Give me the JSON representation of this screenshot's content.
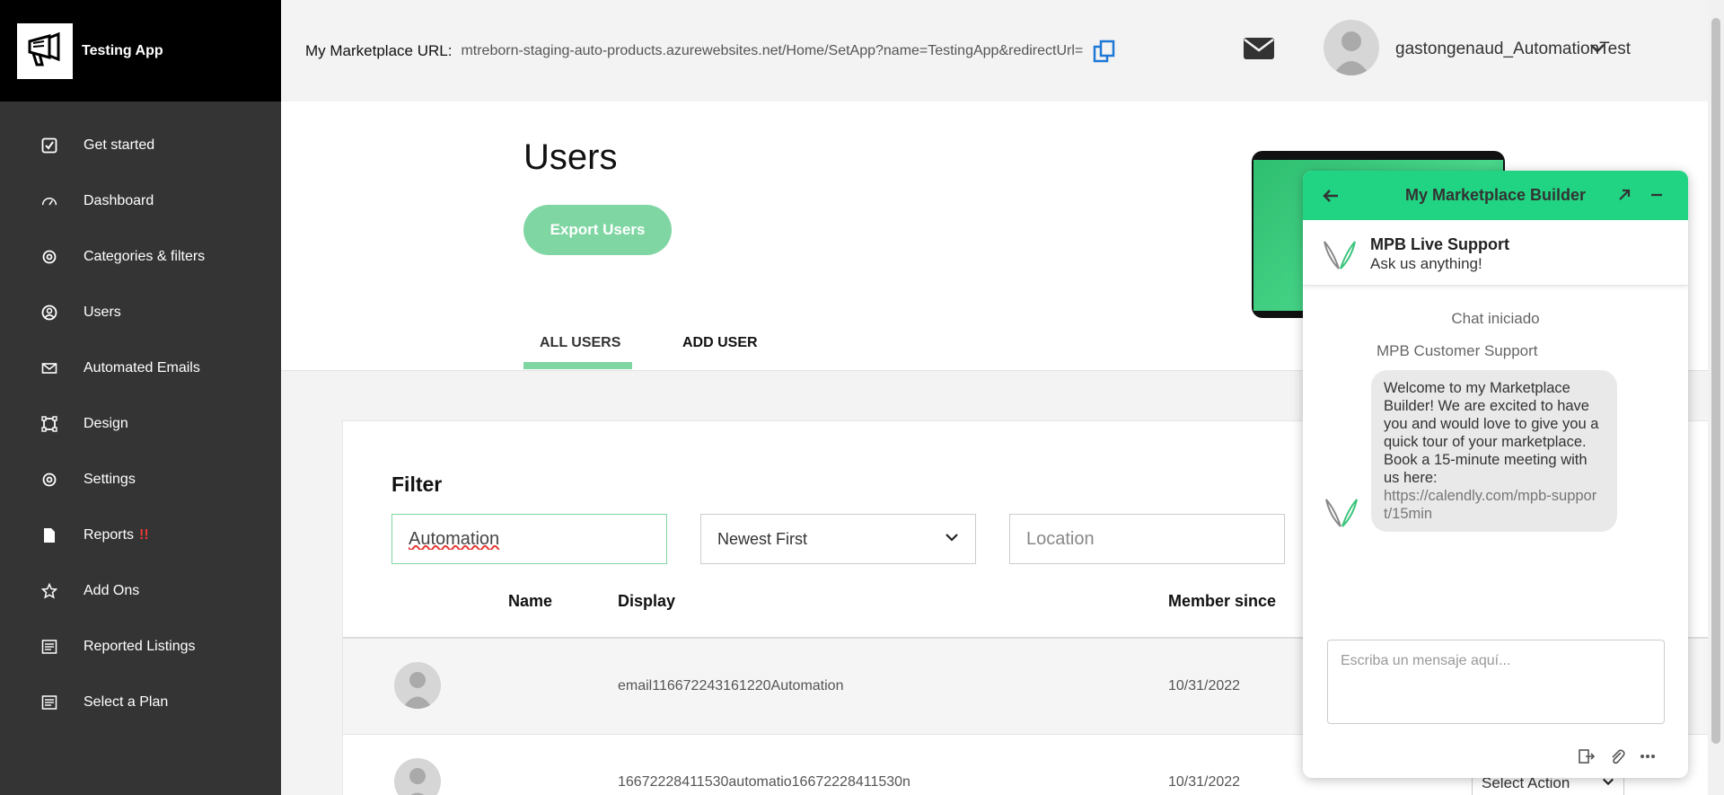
{
  "app": {
    "name": "Testing App"
  },
  "sidebar": {
    "items": [
      {
        "label": "Get started",
        "icon": "checkbox-icon"
      },
      {
        "label": "Dashboard",
        "icon": "gauge-icon"
      },
      {
        "label": "Categories & filters",
        "icon": "gear-icon"
      },
      {
        "label": "Users",
        "icon": "user-circle-icon"
      },
      {
        "label": "Automated Emails",
        "icon": "envelope-icon"
      },
      {
        "label": "Design",
        "icon": "frame-icon"
      },
      {
        "label": "Settings",
        "icon": "gear-icon"
      },
      {
        "label": "Reports",
        "icon": "file-icon",
        "alert": "!!"
      },
      {
        "label": "Add Ons",
        "icon": "star-icon"
      },
      {
        "label": "Reported Listings",
        "icon": "list-icon"
      },
      {
        "label": "Select a Plan",
        "icon": "list-icon"
      }
    ]
  },
  "header": {
    "url_label": "My Marketplace URL:",
    "url_value": "mtreborn-staging-auto-products.azurewebsites.net/Home/SetApp?name=TestingApp&redirectUrl=",
    "username": "gastongenaud_AutomationTest"
  },
  "page": {
    "title": "Users",
    "export_label": "Export Users",
    "tabs": [
      {
        "label": "ALL USERS"
      },
      {
        "label": "ADD USER"
      }
    ]
  },
  "filter": {
    "title": "Filter",
    "search_value": "Automation",
    "sort_value": "Newest First",
    "location_placeholder": "Location"
  },
  "table": {
    "columns": {
      "name": "Name",
      "display": "Display",
      "member_since": "Member since"
    },
    "rows": [
      {
        "display": "email116672243161220Automation",
        "member_since": "10/31/2022"
      },
      {
        "display": "16672228411530automatio16672228411530n",
        "member_since": "10/31/2022",
        "action": "Select Action"
      }
    ]
  },
  "chat": {
    "title": "My Marketplace Builder",
    "support_name": "MPB Live Support",
    "support_sub": "Ask us anything!",
    "started": "Chat iniciado",
    "sender": "MPB Customer Support",
    "message": "Welcome to my Marketplace Builder! We are excited to have you and would love to give you a quick tour of your marketplace. Book a 15-minute meeting with us here:",
    "link": "https://calendly.com/mpb-support/15min",
    "input_placeholder": "Escriba un mensaje aquí..."
  },
  "colors": {
    "accent": "#7fd6a3",
    "chat_header": "#21d483",
    "sidebar": "#343434",
    "alert": "#e53935"
  }
}
